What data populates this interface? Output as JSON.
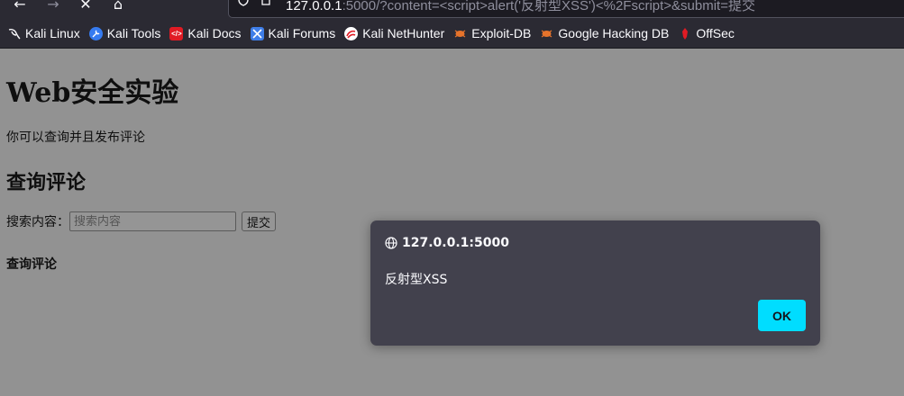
{
  "browser": {
    "url": {
      "host": "127.0.0.1",
      "rest": ":5000/?content=<script>alert('反射型XSS')<%2Fscript>&submit=提交"
    },
    "bookmarks": [
      {
        "label": "Kali Linux",
        "icon": "kali-dragon-icon",
        "color": "#fbfbfe"
      },
      {
        "label": "Kali Tools",
        "icon": "kali-tools-icon",
        "color": "#367bf0"
      },
      {
        "label": "Kali Docs",
        "icon": "kali-docs-icon",
        "color": "#e01b24"
      },
      {
        "label": "Kali Forums",
        "icon": "kali-forums-icon",
        "color": "#3f7ee8"
      },
      {
        "label": "Kali NetHunter",
        "icon": "nethunter-icon",
        "color": "#e01b24"
      },
      {
        "label": "Exploit-DB",
        "icon": "exploit-db-icon",
        "color": "#e6732b"
      },
      {
        "label": "Google Hacking DB",
        "icon": "ghdb-icon",
        "color": "#e6732b"
      },
      {
        "label": "OffSec",
        "icon": "offsec-icon",
        "color": "#e01b24"
      }
    ]
  },
  "page": {
    "title": "Web安全实验",
    "description": "你可以查询并且发布评论",
    "query_heading": "查询评论",
    "search_label": "搜索内容：",
    "search_placeholder": "搜索内容",
    "submit_label": "提交",
    "result_heading": "查询评论"
  },
  "dialog": {
    "origin": "127.0.0.1:5000",
    "message": "反射型XSS",
    "ok_label": "OK",
    "accent": "#00ddff"
  }
}
